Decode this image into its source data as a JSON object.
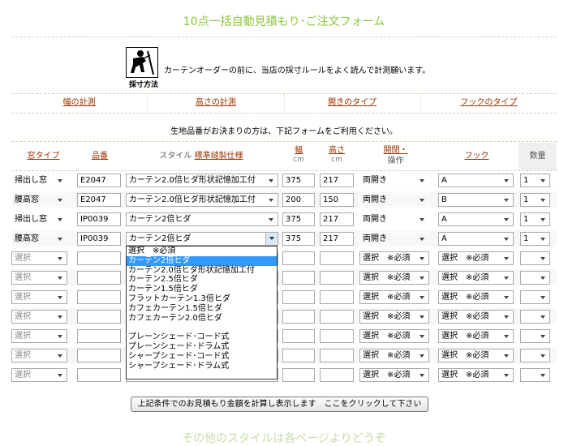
{
  "page": {
    "title": "10点一括自動見積もり･ご注文フォーム",
    "footer_title": "その他のスタイルは各ページよりどうぞ"
  },
  "logo": {
    "caption": "採寸方法",
    "icon": "measuring-person-icon"
  },
  "intro": "カーテンオーダーの前に、当店の採寸ルールをよく読んで計測願います。",
  "nav": [
    "幅の計測",
    "高さの計測",
    "開きのタイプ",
    "フックのタイプ"
  ],
  "notice": "生地品番がお決まりの方は、下記フォームをご利用ください。",
  "table": {
    "headers": {
      "window": "窓タイプ",
      "code": "品番",
      "style_prefix": "スタイル",
      "style_link": "標準縫製仕様",
      "width": "幅",
      "width_unit": "cm",
      "height": "高さ",
      "height_unit": "cm",
      "open_line1": "開閉・",
      "open_line2": "操作",
      "hook": "フック",
      "qty": "数量"
    },
    "rows": [
      {
        "window": "掃出し窓",
        "code": "E2047",
        "style": "カーテン2.0倍ヒダ形状記憶加工付",
        "width": "375",
        "height": "217",
        "open": "両開き",
        "hook": "A",
        "qty": "1"
      },
      {
        "window": "腰高窓",
        "code": "E2047",
        "style": "カーテン2.0倍ヒダ形状記憶加工付",
        "width": "200",
        "height": "150",
        "open": "両開き",
        "hook": "B",
        "qty": "1"
      },
      {
        "window": "掃出し窓",
        "code": "IP0039",
        "style": "カーテン2倍ヒダ",
        "width": "375",
        "height": "217",
        "open": "両開き",
        "hook": "A",
        "qty": "1"
      },
      {
        "window": "腰高窓",
        "code": "IP0039",
        "style": "カーテン2倍ヒダ",
        "width": "375",
        "height": "217",
        "open": "両開き",
        "hook": "A",
        "qty": "1"
      },
      {
        "window": "選択",
        "code": "",
        "style": "",
        "width": "",
        "height": "",
        "open": "選択　※必須",
        "hook": "選択　※必須",
        "qty": ""
      },
      {
        "window": "選択",
        "code": "",
        "style": "",
        "width": "",
        "height": "",
        "open": "選択　※必須",
        "hook": "選択　※必須",
        "qty": ""
      },
      {
        "window": "選択",
        "code": "",
        "style": "",
        "width": "",
        "height": "",
        "open": "選択　※必須",
        "hook": "選択　※必須",
        "qty": ""
      },
      {
        "window": "選択",
        "code": "",
        "style": "",
        "width": "",
        "height": "",
        "open": "選択　※必須",
        "hook": "選択　※必須",
        "qty": ""
      },
      {
        "window": "選択",
        "code": "",
        "style": "",
        "width": "",
        "height": "",
        "open": "選択　※必須",
        "hook": "選択　※必須",
        "qty": ""
      },
      {
        "window": "選択",
        "code": "",
        "style": "",
        "width": "",
        "height": "",
        "open": "選択　※必須",
        "hook": "選択　※必須",
        "qty": ""
      },
      {
        "window": "選択",
        "code": "",
        "style": "",
        "width": "",
        "height": "",
        "open": "選択　※必須",
        "hook": "選択　※必須",
        "qty": ""
      }
    ]
  },
  "style_dropdown": {
    "options": [
      "選択　※必須",
      "カーテン2倍ヒダ",
      "カーテン2.0倍ヒダ形状記憶加工付",
      "カーテン2.5倍ヒダ",
      "カーテン1.5倍ヒダ",
      "フラットカーテン1.3倍ヒダ",
      "カフェカーテン1.5倍ヒダ",
      "カフェカーテン2.0倍ヒダ",
      "",
      "プレーンシェード･コード式",
      "プレーンシェード･ドラム式",
      "シャープシェード･コード式",
      "シャープシェード･ドラム式"
    ],
    "highlighted_index": 1
  },
  "calc_button": "上記条件でのお見積もり金額を計算し表示します　ここをクリックして下さい",
  "colors": {
    "title_green": "#8cc63f",
    "link_brown": "#993300",
    "highlight_blue": "#3399ff"
  }
}
